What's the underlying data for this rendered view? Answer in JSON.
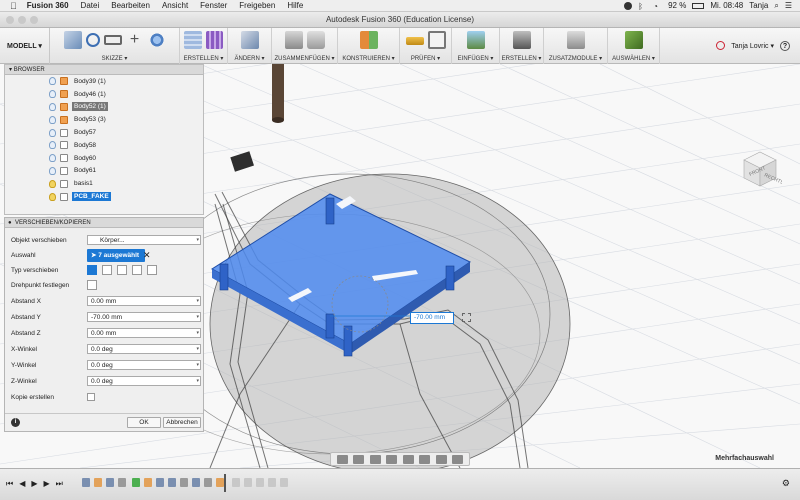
{
  "menubar": {
    "app_name": "Fusion 360",
    "items": [
      "Datei",
      "Bearbeiten",
      "Ansicht",
      "Fenster",
      "Freigeben",
      "Hilfe"
    ],
    "battery": "92 %",
    "clock": "Mi. 08:48",
    "user": "Tanja"
  },
  "window": {
    "title": "Autodesk Fusion 360 (Education License)"
  },
  "ribbon": {
    "workspace": "MODELL ▾",
    "groups": [
      {
        "label": "SKIZZE ▾"
      },
      {
        "label": "ERSTELLEN ▾"
      },
      {
        "label": "ÄNDERN ▾"
      },
      {
        "label": "ZUSAMMENFÜGEN ▾"
      },
      {
        "label": "KONSTRUIEREN ▾"
      },
      {
        "label": "PRÜFEN ▾"
      },
      {
        "label": "EINFÜGEN ▾"
      },
      {
        "label": "ERSTELLEN ▾"
      },
      {
        "label": "ZUSATZMODULE ▾"
      },
      {
        "label": "AUSWÄHLEN ▾"
      }
    ],
    "user_name": "Tanja Lovric ▾",
    "help": "?"
  },
  "browser": {
    "title": "BROWSER",
    "items": [
      {
        "label": "Body39 (1)",
        "state": ""
      },
      {
        "label": "Body46 (1)",
        "state": ""
      },
      {
        "label": "Body52 (1)",
        "state": "grey"
      },
      {
        "label": "Body53 (3)",
        "state": ""
      },
      {
        "label": "Body57",
        "state": ""
      },
      {
        "label": "Body58",
        "state": ""
      },
      {
        "label": "Body60",
        "state": ""
      },
      {
        "label": "Body61",
        "state": ""
      },
      {
        "label": "basis1",
        "state": ""
      },
      {
        "label": "PCB_FAKE",
        "state": "blue"
      }
    ]
  },
  "dialog": {
    "title": "VERSCHIEBEN/KOPIEREN",
    "move_object_label": "Objekt verschieben",
    "move_object_value": "Körper...",
    "selection_label": "Auswahl",
    "selection_value": "7 ausgewählt",
    "move_type_label": "Typ verschieben",
    "pivot_label": "Drehpunkt festlegen",
    "fields": [
      {
        "label": "Abstand X",
        "value": "0.00 mm"
      },
      {
        "label": "Abstand Y",
        "value": "-70.00 mm"
      },
      {
        "label": "Abstand Z",
        "value": "0.00 mm"
      },
      {
        "label": "X-Winkel",
        "value": "0.0 deg"
      },
      {
        "label": "Y-Winkel",
        "value": "0.0 deg"
      },
      {
        "label": "Z-Winkel",
        "value": "0.0 deg"
      }
    ],
    "copy_label": "Kopie erstellen",
    "ok": "OK",
    "cancel": "Abbrechen",
    "info": "i"
  },
  "canvas": {
    "distance_input": "-70.00 mm"
  },
  "status": {
    "selection_mode": "Mehrfachauswahl"
  },
  "viewcube": {
    "front": "FRONT",
    "right": "RECHTS"
  },
  "colors": {
    "accent": "#1c78d4",
    "pcb": "#4f8bf0",
    "ground": "#c8c8c8"
  }
}
